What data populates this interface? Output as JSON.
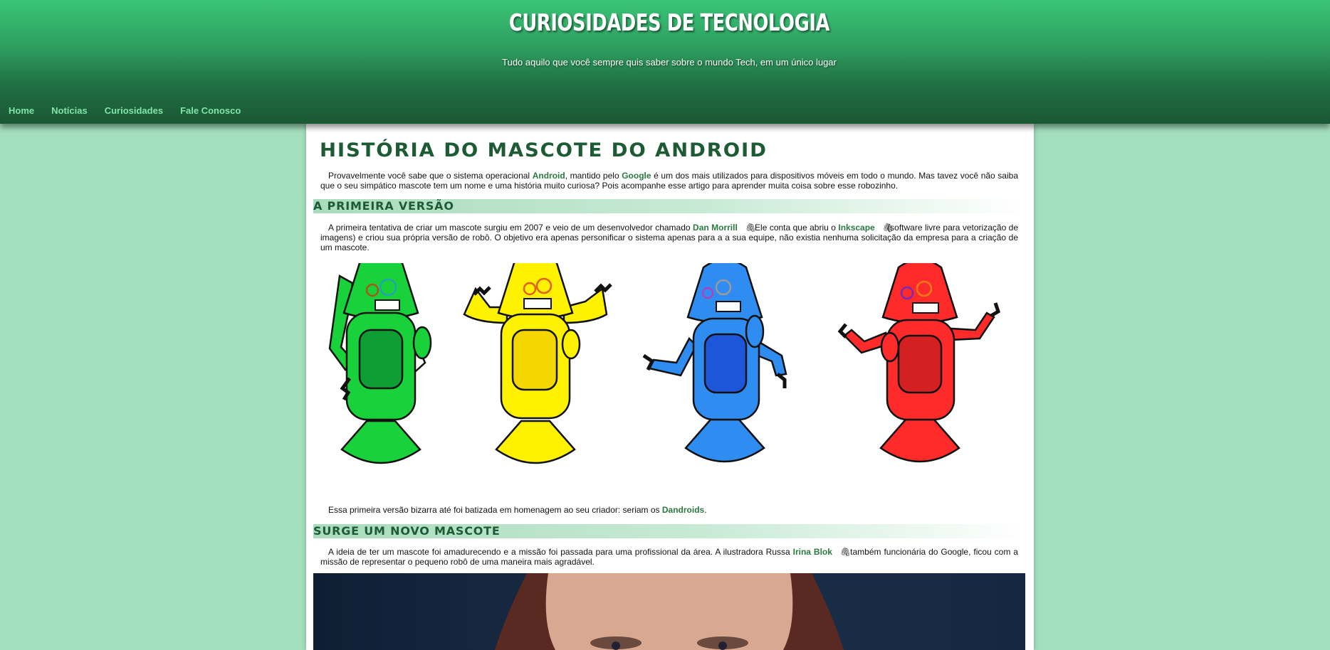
{
  "site": {
    "title": "CURIOSIDADES DE TECNOLOGIA",
    "subtitle": "Tudo aquilo que você sempre quis saber sobre o mundo Tech, em um único lugar"
  },
  "nav": [
    "Home",
    "Notícias",
    "Curiosidades",
    "Fale Conosco"
  ],
  "article": {
    "title": "HISTÓRIA DO MASCOTE DO ANDROID",
    "intro": {
      "t1": "Provavelmente você sabe que o sistema operacional ",
      "link1": "Android",
      "t2": ", mantido pelo ",
      "link2": "Google",
      "t3": " é um dos mais utilizados para dispositivos móveis em todo o mundo. Mas tavez você não saiba que o seu simpático mascote tem um nome e uma história muito curiosa? Pois acompanhe esse artigo para aprender muita coisa sobre esse robozinho."
    },
    "section1": {
      "heading": "A PRIMEIRA VERSÃO",
      "p1": {
        "t1": "A primeira tentativa de criar um mascote surgiu em 2007 e veio de um desenvolvedor chamado ",
        "link1": "Dan Morrill",
        "t2": " . Ele conta que abriu o ",
        "link2": "Inkscape",
        "t3": " (software livre para vetorização de imagens) e criou sua própria versão de robô. O objetivo era apenas personificar o sistema apenas para a a sua equipe, não existia nenhuma solicitação da empresa para a criação de um mascote."
      },
      "p2": {
        "t1": "Essa primeira versão bizarra até foi batizada em homenagem ao seu criador: seriam os ",
        "link1": "Dandroids",
        "t2": "."
      }
    },
    "section2": {
      "heading": "SURGE UM NOVO MASCOTE",
      "p1": {
        "t1": "A ideia de ter um mascote foi amadurecendo e a missão foi passada para uma profissional da área. A ilustradora Russa ",
        "link1": "Irina Blok",
        "t2": " , também funcionária do Google, ficou com a missão de representar o pequeno robô de uma maneira mais agradável."
      }
    }
  },
  "icons": {
    "external_link": "paperclip-icon"
  },
  "robots": [
    {
      "name": "green-robot",
      "color": "#19d13a",
      "dark": "#0f9e34"
    },
    {
      "name": "yellow-robot",
      "color": "#fff200",
      "dark": "#f4d600"
    },
    {
      "name": "blue-robot",
      "color": "#2f8cf0",
      "dark": "#1d56d8"
    },
    {
      "name": "red-robot",
      "color": "#ff2a2a",
      "dark": "#d42020"
    }
  ],
  "colors": {
    "accent": "#1d5b35",
    "link": "#2a7a3f",
    "nav_link": "#7fe6a6",
    "background": "#a3dfbd"
  }
}
